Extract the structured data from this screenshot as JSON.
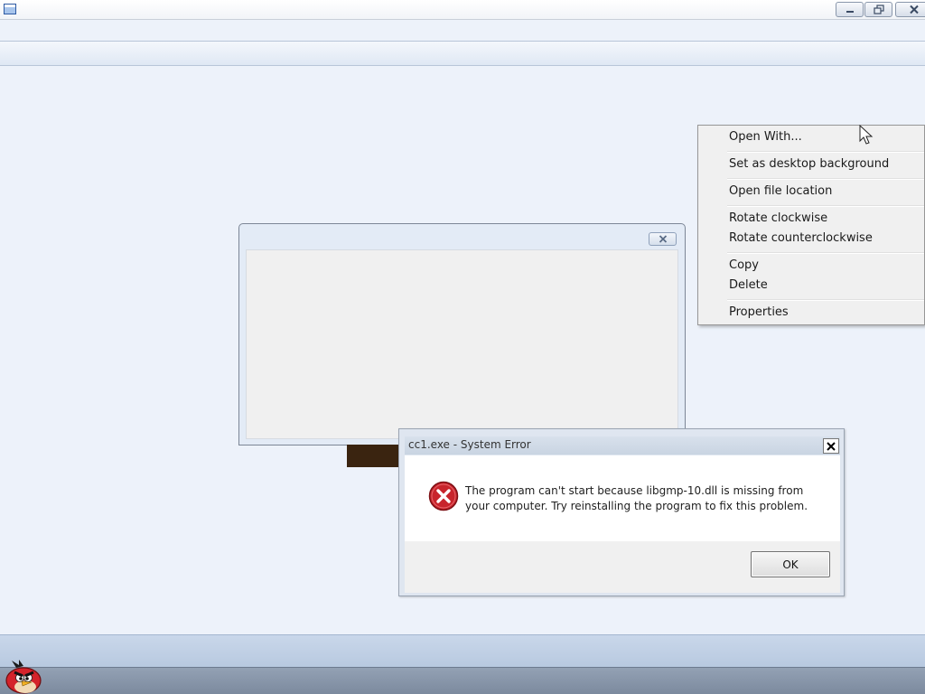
{
  "window": {
    "title": "",
    "icons": {
      "app": "window-app-icon",
      "minimize": "minimize-icon",
      "restore": "restore-icon",
      "close": "close-icon"
    }
  },
  "background_window": {
    "title": "",
    "close_icon": "close-icon"
  },
  "context_menu": {
    "items": [
      {
        "label": "Open With..."
      },
      {
        "label": "Set as desktop background"
      },
      {
        "label": "Open file location"
      },
      {
        "label": "Rotate clockwise"
      },
      {
        "label": "Rotate counterclockwise"
      },
      {
        "label": "Copy"
      },
      {
        "label": "Delete"
      },
      {
        "label": "Properties"
      }
    ]
  },
  "error_dialog": {
    "title": "cc1.exe - System Error",
    "message_line1": "The program can't start because libgmp-10.dll is missing from",
    "message_line2": "your computer. Try reinstalling the program to fix this problem.",
    "ok_label": "OK",
    "icon": "error-icon",
    "colors": {
      "error_red": "#c8242c"
    }
  },
  "taskbar": {
    "pinned_icon": "angry-bird-icon"
  }
}
